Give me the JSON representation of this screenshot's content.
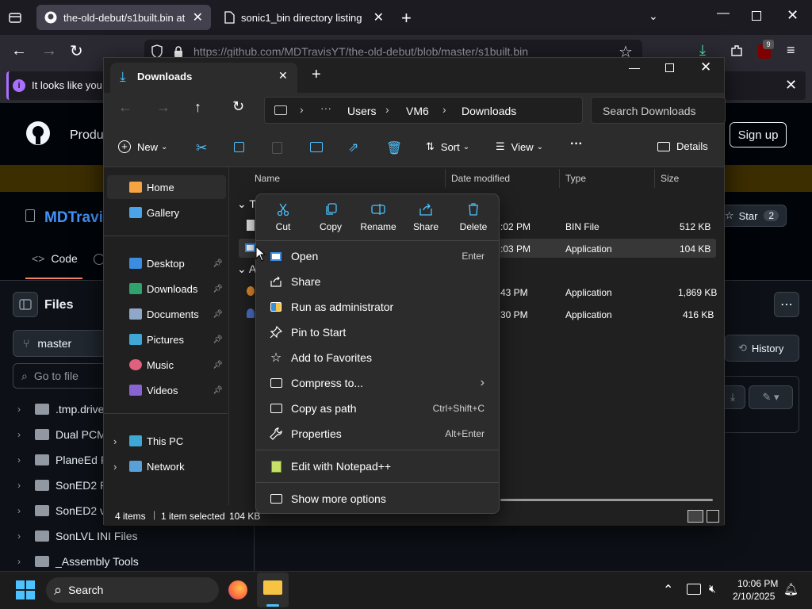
{
  "browser": {
    "tabs": [
      {
        "title": "the-old-debut/s1built.bin at m"
      },
      {
        "title": "sonic1_bin directory listing"
      }
    ],
    "url": "https://github.com/MDTravisYT/the-old-debut/blob/master/s1built.bin",
    "notification_count": "9",
    "notice": "It looks like you h"
  },
  "github": {
    "product_label": "Produ",
    "signup": "Sign up",
    "owner": "MDTravis",
    "star_label": "Star",
    "star_count": "2",
    "code_tab": "Code",
    "files_label": "Files",
    "branch": "master",
    "search_placeholder": "Go to file",
    "history": "History",
    "tree": [
      ".tmp.drived",
      "Dual PCM",
      "PlaneEd Pr",
      "SonED2 Pr",
      "SonED2 v1",
      "SonLVL INI Files",
      "_Assembly Tools"
    ]
  },
  "explorer": {
    "tab_title": "Downloads",
    "breadcrumb": [
      "Users",
      "VM6",
      "Downloads"
    ],
    "search_placeholder": "Search Downloads",
    "toolbar": {
      "new": "New",
      "sort": "Sort",
      "view": "View",
      "details": "Details"
    },
    "nav": {
      "home": "Home",
      "gallery": "Gallery",
      "desktop": "Desktop",
      "downloads": "Downloads",
      "documents": "Documents",
      "pictures": "Pictures",
      "music": "Music",
      "videos": "Videos",
      "thispc": "This PC",
      "network": "Network"
    },
    "columns": {
      "name": "Name",
      "date": "Date modified",
      "type": "Type",
      "size": "Size"
    },
    "group1_initial": "To",
    "group2_initial": "A",
    "rows": [
      {
        "date": ":02 PM",
        "type": "BIN File",
        "size": "512 KB"
      },
      {
        "date": ":03 PM",
        "type": "Application",
        "size": "104 KB"
      },
      {
        "date": "43 PM",
        "type": "Application",
        "size": "1,869 KB"
      },
      {
        "date": "30 PM",
        "type": "Application",
        "size": "416 KB"
      }
    ],
    "status": {
      "items": "4 items",
      "selected": "1 item selected",
      "size": "104 KB"
    }
  },
  "context_menu": {
    "top_actions": [
      "Cut",
      "Copy",
      "Rename",
      "Share",
      "Delete"
    ],
    "items": [
      {
        "label": "Open",
        "shortcut": "Enter"
      },
      {
        "label": "Share",
        "shortcut": ""
      },
      {
        "label": "Run as administrator",
        "shortcut": ""
      },
      {
        "label": "Pin to Start",
        "shortcut": ""
      },
      {
        "label": "Add to Favorites",
        "shortcut": ""
      },
      {
        "label": "Compress to...",
        "shortcut": ""
      },
      {
        "label": "Copy as path",
        "shortcut": "Ctrl+Shift+C"
      },
      {
        "label": "Properties",
        "shortcut": "Alt+Enter"
      },
      {
        "label": "Edit with Notepad++",
        "shortcut": ""
      },
      {
        "label": "Show more options",
        "shortcut": ""
      }
    ]
  },
  "taskbar": {
    "search": "Search",
    "time": "10:06 PM",
    "date": "2/10/2025"
  }
}
